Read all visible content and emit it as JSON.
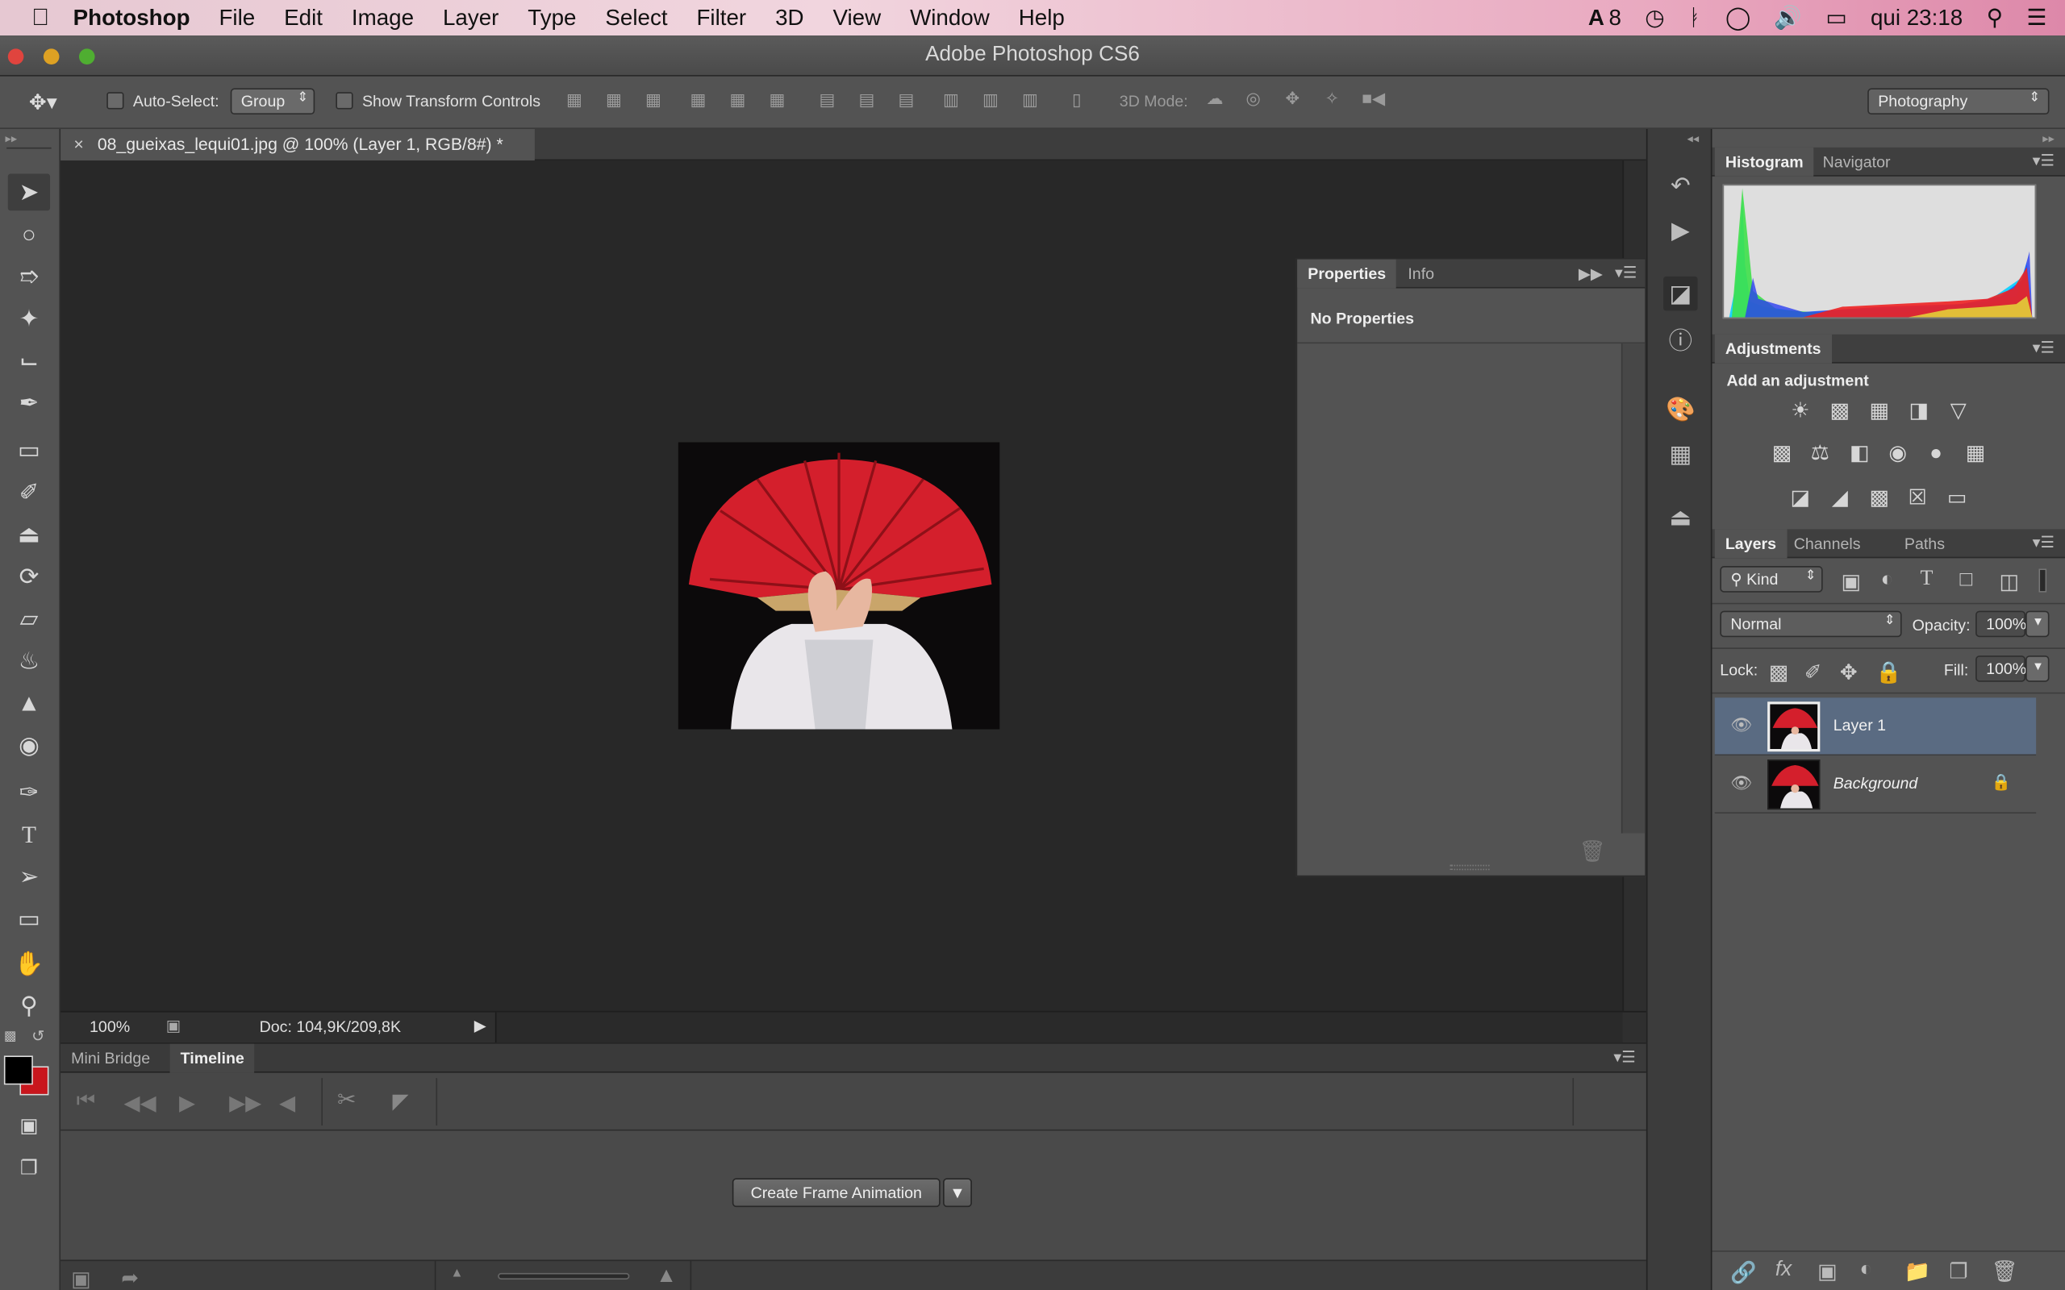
{
  "menubar": {
    "apple_icon": "apple-icon",
    "items": [
      "Photoshop",
      "File",
      "Edit",
      "Image",
      "Layer",
      "Type",
      "Select",
      "Filter",
      "3D",
      "View",
      "Window",
      "Help"
    ],
    "status_count": "8",
    "clock": "qui 23:18"
  },
  "window": {
    "title": "Adobe Photoshop CS6"
  },
  "options": {
    "auto_select_label": "Auto-Select:",
    "auto_select_value": "Group",
    "show_transform_label": "Show Transform Controls",
    "mode_label": "3D Mode:",
    "workspace": "Photography"
  },
  "document": {
    "tab_label": "08_gueixas_lequi01.jpg @ 100% (Layer 1, RGB/8#) *"
  },
  "status": {
    "zoom": "100%",
    "doc": "Doc: 104,9K/209,8K"
  },
  "timeline": {
    "tabs": [
      "Mini Bridge",
      "Timeline"
    ],
    "create_button": "Create Frame Animation"
  },
  "properties": {
    "tabs": [
      "Properties",
      "Info"
    ],
    "empty_text": "No Properties"
  },
  "histogram": {
    "tabs": [
      "Histogram",
      "Navigator"
    ]
  },
  "adjustments": {
    "tab": "Adjustments",
    "heading": "Add an adjustment"
  },
  "layers": {
    "tabs": [
      "Layers",
      "Channels",
      "Paths"
    ],
    "filter_kind": "Kind",
    "blend_mode": "Normal",
    "opacity_label": "Opacity:",
    "opacity_value": "100%",
    "lock_label": "Lock:",
    "fill_label": "Fill:",
    "fill_value": "100%",
    "items": [
      {
        "name": "Layer 1",
        "selected": true
      },
      {
        "name": "Background",
        "selected": false
      }
    ]
  },
  "colors": {
    "foreground": "#000000",
    "background": "#c8161d",
    "accent_selected": "#5a6b82"
  }
}
